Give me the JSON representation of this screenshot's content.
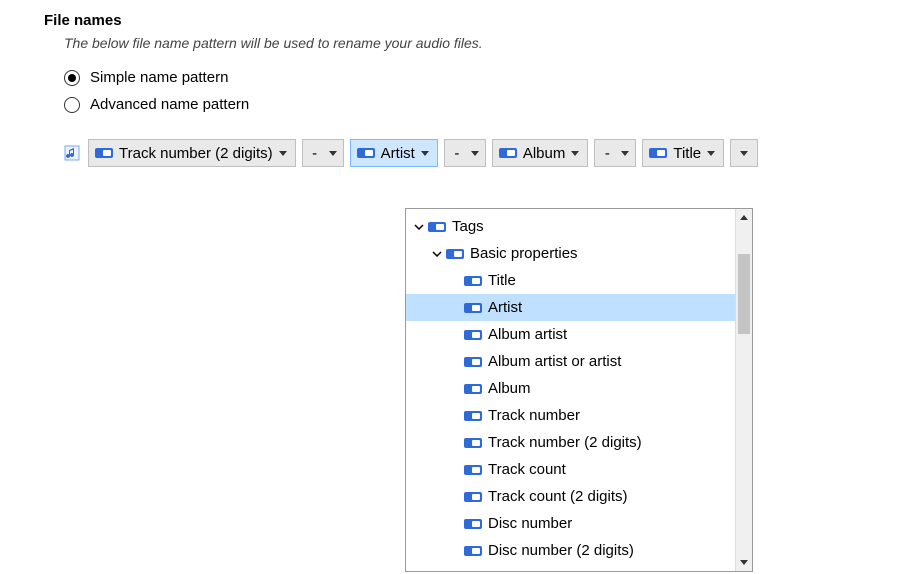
{
  "section": {
    "title": "File names",
    "description": "The below file name pattern will be used to rename your audio files."
  },
  "mode": {
    "simple_label": "Simple name pattern",
    "advanced_label": "Advanced name pattern",
    "selected": "simple"
  },
  "pattern": {
    "separator": "-",
    "tokens": {
      "track2": "Track number (2 digits)",
      "artist": "Artist",
      "album": "Album",
      "title": "Title"
    }
  },
  "dropdown": {
    "root": "Tags",
    "group": "Basic properties",
    "items": [
      "Title",
      "Artist",
      "Album artist",
      "Album artist or artist",
      "Album",
      "Track number",
      "Track number (2 digits)",
      "Track count",
      "Track count (2 digits)",
      "Disc number",
      "Disc number (2 digits)"
    ],
    "selected_index": 1
  },
  "colors": {
    "tag_blue": "#2f6bd8",
    "tag_white": "#ffffff",
    "selection": "#bfe0ff",
    "token_selected_bg": "#cfe6ff",
    "token_selected_border": "#7ab8ff"
  }
}
